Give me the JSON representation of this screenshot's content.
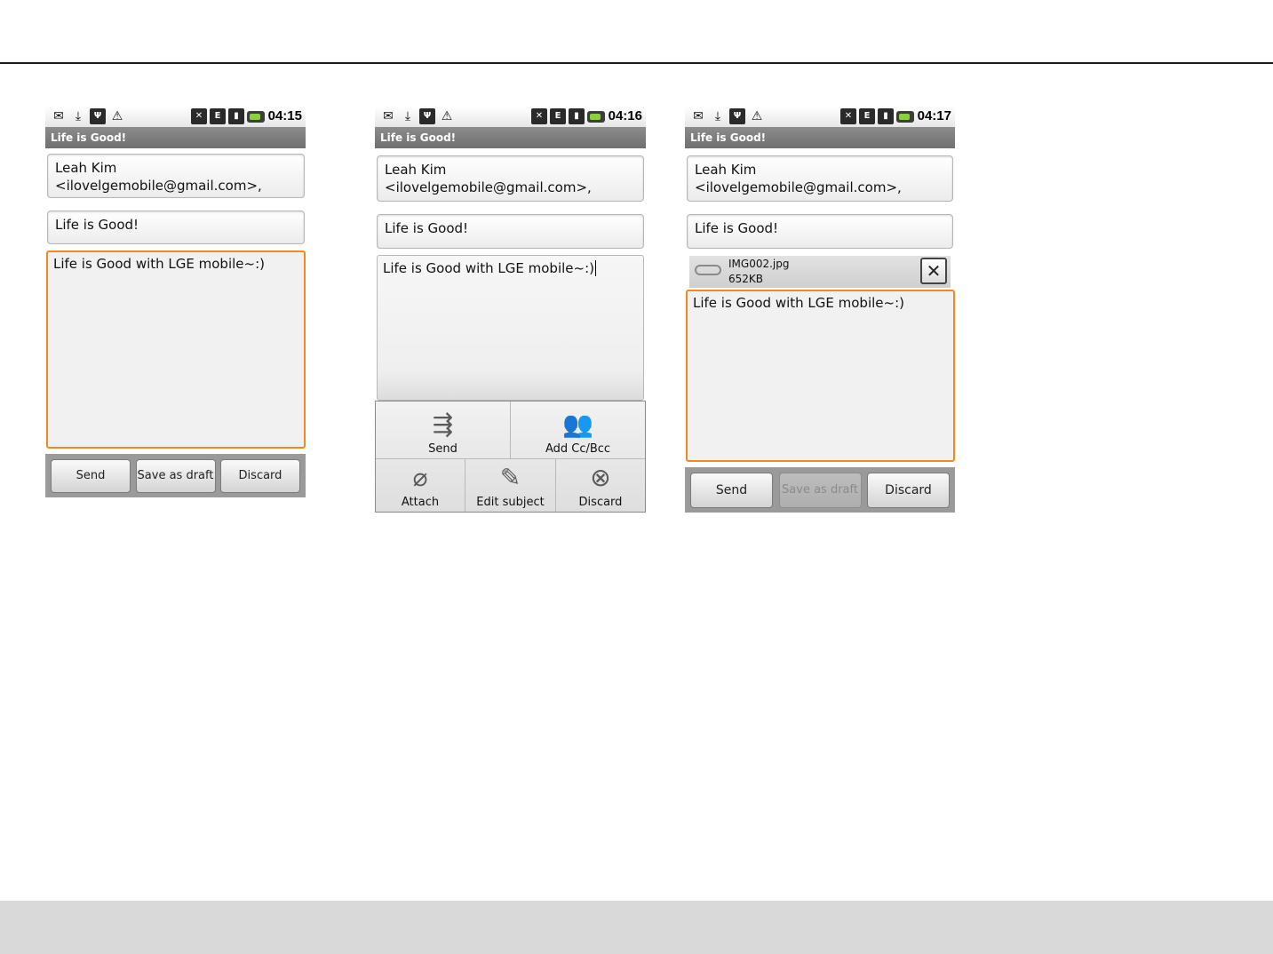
{
  "screens": [
    {
      "time": "04:15",
      "title": "Life is Good!",
      "to": "Leah Kim <ilovelgemobile@gmail.com>,",
      "subject": "Life is Good!",
      "body": "Life is Good with LGE mobile~:)",
      "buttons": {
        "send": "Send",
        "save_draft": "Save as draft",
        "discard": "Discard"
      }
    },
    {
      "time": "04:16",
      "title": "Life is Good!",
      "to": "Leah Kim <ilovelgemobile@gmail.com>,",
      "subject": "Life is Good!",
      "body": "Life is Good with LGE mobile~:)",
      "menu": {
        "send": "Send",
        "add_cc_bcc": "Add Cc/Bcc",
        "attach": "Attach",
        "edit_subject": "Edit subject",
        "discard": "Discard"
      }
    },
    {
      "time": "04:17",
      "title": "Life is Good!",
      "to": "Leah Kim <ilovelgemobile@gmail.com>,",
      "subject": "Life is Good!",
      "attachment": {
        "name": "IMG002.jpg",
        "size": "652KB"
      },
      "body": "Life is Good with LGE mobile~:)",
      "buttons": {
        "send": "Send",
        "save_draft": "Save as draft",
        "discard": "Discard"
      }
    }
  ],
  "status_icons": [
    "mail-error-icon",
    "download-icon",
    "usb-icon",
    "warning-icon",
    "mute-icon",
    "edge-data-icon",
    "signal-icon",
    "battery-icon"
  ],
  "colors": {
    "focus": "#f08a1c",
    "titlebar": "#7d7d7d",
    "battery": "#8ad13d"
  }
}
